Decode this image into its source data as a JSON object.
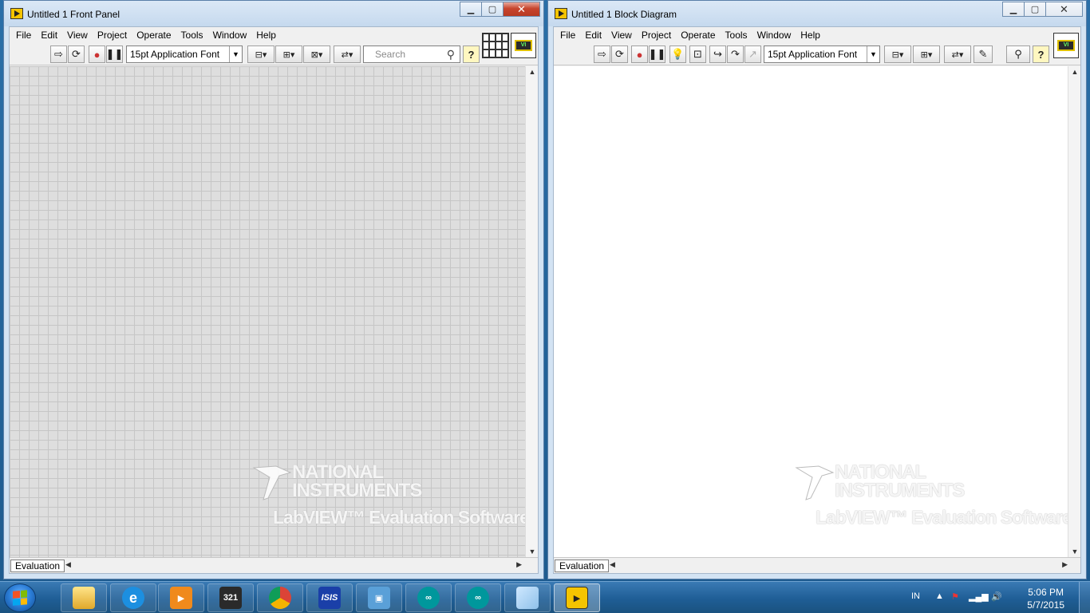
{
  "front_panel": {
    "title": "Untitled 1 Front Panel",
    "menu": [
      "File",
      "Edit",
      "View",
      "Project",
      "Operate",
      "Tools",
      "Window",
      "Help"
    ],
    "font_ring": "15pt Application Font",
    "search_placeholder": "Search",
    "status_label": "Evaluation"
  },
  "block_diagram": {
    "title": "Untitled 1 Block Diagram",
    "menu": [
      "File",
      "Edit",
      "View",
      "Project",
      "Operate",
      "Tools",
      "Window",
      "Help"
    ],
    "font_ring": "15pt Application Font",
    "status_label": "Evaluation"
  },
  "watermark": {
    "company_line1": "NATIONAL",
    "company_line2": "INSTRUMENTS",
    "product": "LabVIEW™ Evaluation Software"
  },
  "taskbar": {
    "apps": [
      "Windows Explorer",
      "Internet Explorer",
      "Windows Media Player",
      "Media Player Classic",
      "Google Chrome",
      "ISIS",
      "Remote Desktop",
      "Arduino",
      "Arduino",
      "Notepad",
      "LabVIEW"
    ],
    "tray_lang": "IN",
    "time": "5:06 PM",
    "date": "5/7/2015"
  },
  "colors": {
    "taskbar": "#1f5e96",
    "fp_grid": "#dedede",
    "close_button": "#c7452e"
  }
}
